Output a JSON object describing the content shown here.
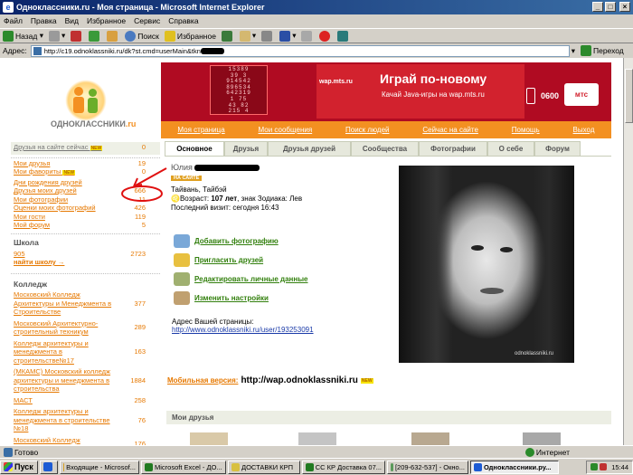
{
  "window": {
    "title": "Одноклассники.ru - Моя страница - Microsoft Internet Explorer",
    "min": "_",
    "max": "□",
    "close": "×"
  },
  "menu": [
    "Файл",
    "Правка",
    "Вид",
    "Избранное",
    "Сервис",
    "Справка"
  ],
  "toolbar": {
    "back": "Назад",
    "search": "Поиск",
    "favorites": "Избранное"
  },
  "address": {
    "label": "Адрес:",
    "url": "http://c19.odnoklassniki.ru/dk?st.cmd=userMain&tkn",
    "go": "Переход"
  },
  "site": {
    "logo_text": "ОДНОКЛАССНИКИ",
    "logo_suffix": ".ru",
    "banner": {
      "headline": "Играй по-новому",
      "sub": "Качай Java-игры на wap.mts.ru",
      "site": "wap.mts.ru",
      "code": "0600",
      "brand": "мтс",
      "grid": [
        "15389",
        "39 3",
        "914542",
        "896534",
        "642319",
        "1  75",
        "43 82",
        "215 4"
      ]
    },
    "nav": [
      "Моя страница",
      "Мои сообщения",
      "Поиск людей",
      "Сейчас на сайте",
      "Помощь",
      "Выход"
    ],
    "sidebar": {
      "online": {
        "label": "Друзья на сайте сейчас",
        "badge": "NEW",
        "count": "0"
      },
      "links": [
        {
          "label": "Мои друзья",
          "count": "19"
        },
        {
          "label": "Мои фавориты",
          "badge": "NEW",
          "count": "0"
        },
        {
          "label": "Дни рождения друзей",
          "count": ""
        },
        {
          "label": "Друзья моих друзей",
          "count": "666"
        },
        {
          "label": "Мои фотографии",
          "count": "11"
        },
        {
          "label": "Оценки моих фотографий",
          "count": "426"
        },
        {
          "label": "Мои гости",
          "count": "119"
        },
        {
          "label": "Мой форум",
          "count": "5"
        }
      ],
      "school": {
        "title": "Школа",
        "item": "905",
        "count": "2723",
        "find": "найти школу →"
      },
      "college": {
        "title": "Колледж",
        "items": [
          {
            "label": "Московский Колледж Архитектуры и Менеджмента в Строительстве",
            "count": "377"
          },
          {
            "label": "Московский Архитектурно-строительный техникум",
            "count": "289"
          },
          {
            "label": "Колледж архитектуры и менеджмента в строительстве№17",
            "count": "163"
          },
          {
            "label": "(МКАМС) Московский колледж архитектуры и менеджмента в строительства",
            "count": "1884"
          },
          {
            "label": "МАСТ",
            "count": "258"
          },
          {
            "label": "Колледж архитектуры и менеджмента в строительстве №18",
            "count": "76"
          },
          {
            "label": "Московский Колледж Архитектуры и Менеджмента в",
            "count": "176"
          }
        ]
      }
    },
    "tabs": [
      "Основное",
      "Друзья",
      "Друзья друзей",
      "Сообщества",
      "Фотографии",
      "О себе",
      "Форум"
    ],
    "profile": {
      "name": "Юлия",
      "status": "НА САЙТЕ",
      "location": "Тайвань, Тайбэй",
      "age_prefix": "Возраст: ",
      "age": "107 лет",
      "zodiac": ", знак Зодиака: Лев",
      "last_visit": "Последний визит: сегодня 16:43"
    },
    "actions": [
      "Добавить фотографию",
      "Пригласить друзей",
      "Редактировать личные данные",
      "Изменить настройки"
    ],
    "page_address": {
      "label": "Адрес Вашей страницы:",
      "url": "http://www.odnoklassniki.ru/user/193253091"
    },
    "mobile": {
      "label": "Мобильная версия:",
      "url": "http://wap.odnoklassniki.ru",
      "badge": "NEW"
    },
    "photo_watermark": "odnoklassniki.ru",
    "friends_title": "Мои друзья"
  },
  "status": {
    "text": "Готово",
    "zone": "Интернет"
  },
  "taskbar": {
    "start": "Пуск",
    "items": [
      "Входящие - Microsof...",
      "Microsoft Excel - ДО...",
      "ДОСТАВКИ КРП",
      "СС КР Доставка 07...",
      "[209-632-537] - Окно...",
      "Одноклассники.ру..."
    ],
    "clock": "15:44"
  },
  "colors": {
    "orange": "#f39021",
    "link": "#e67800",
    "banner": "#b00b22",
    "green_link": "#33800e"
  }
}
